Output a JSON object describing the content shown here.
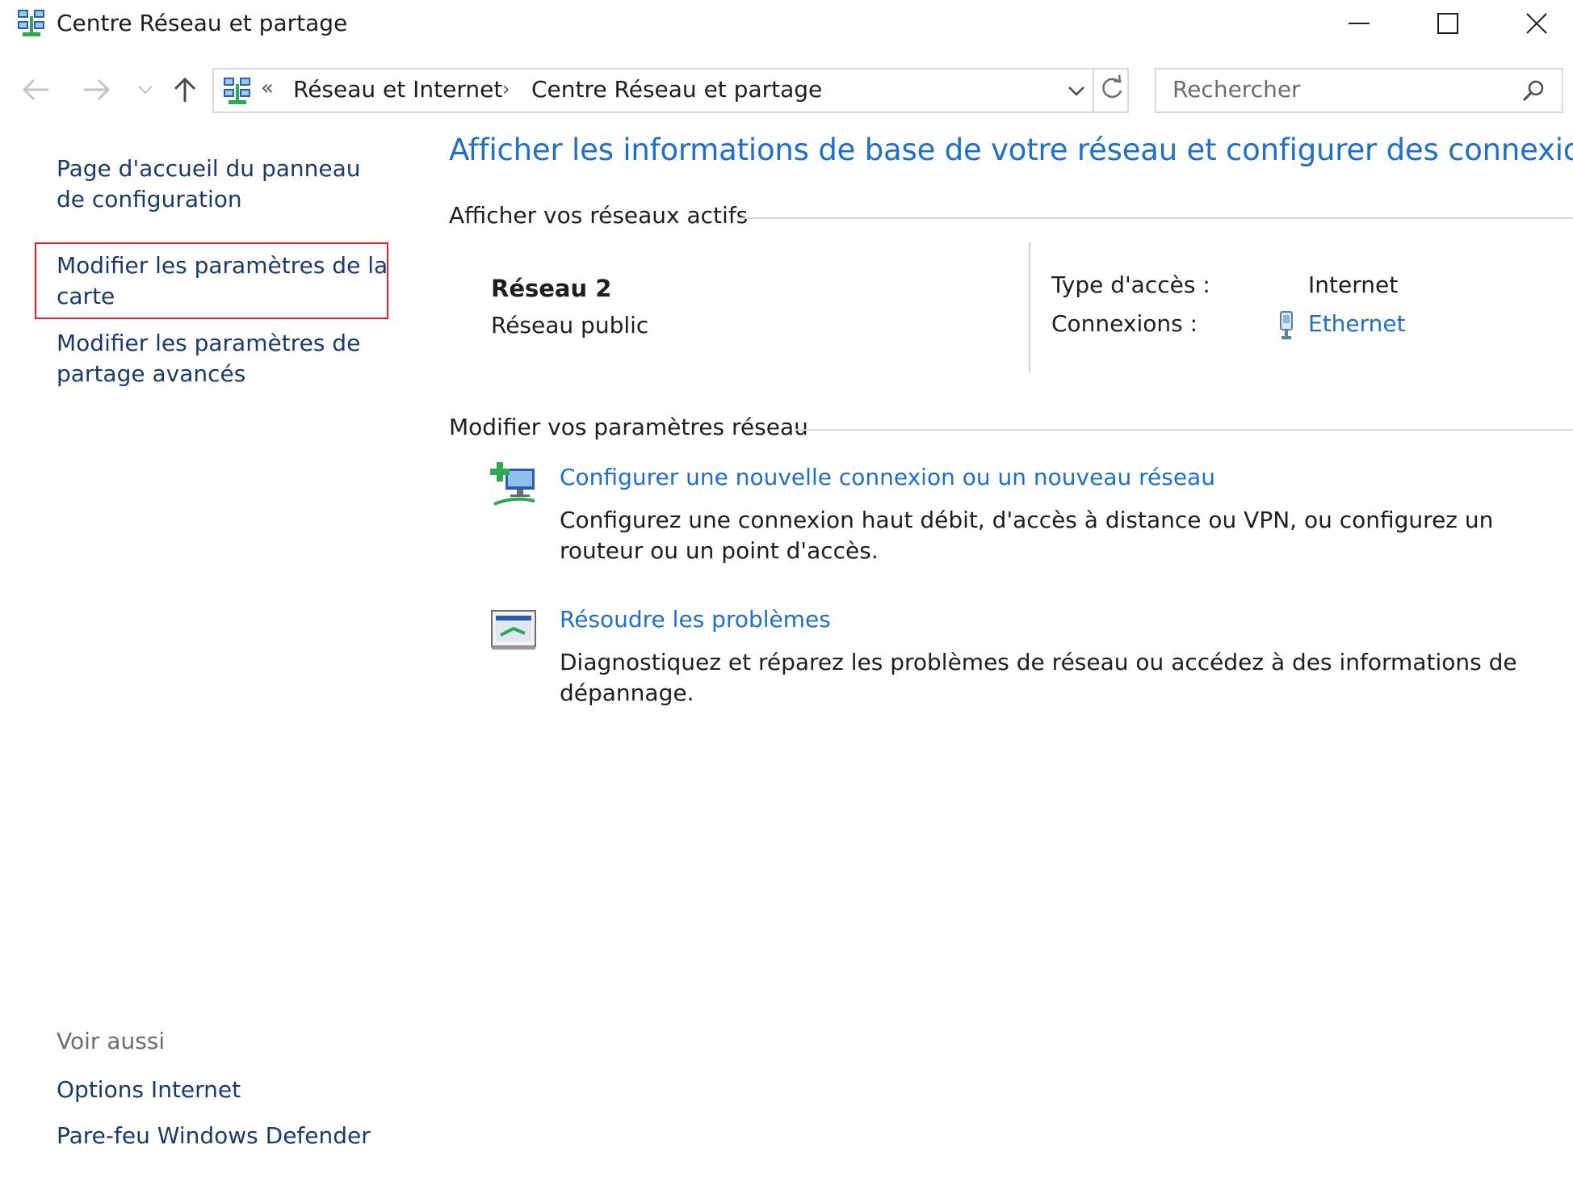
{
  "window": {
    "title": "Centre Réseau et partage"
  },
  "navigation": {
    "breadcrumb_prefix": "«",
    "breadcrumbs": [
      "Réseau et Internet",
      "Centre Réseau et partage"
    ],
    "breadcrumb_separator": "›",
    "search_placeholder": "Rechercher"
  },
  "sidebar": {
    "links": [
      "Page d'accueil du panneau de configuration",
      "Modifier les paramètres de la carte",
      "Modifier les paramètres de partage avancés"
    ],
    "highlighted_link_color": "#e8202a",
    "see_also_heading": "Voir aussi",
    "see_also_links": [
      "Options Internet",
      "Pare-feu Windows Defender"
    ]
  },
  "main": {
    "title": "Afficher les informations de base de votre réseau et configurer des connexions",
    "active_networks_heading": "Afficher vos réseaux actifs",
    "network": {
      "name": "Réseau 2",
      "category": "Réseau public",
      "access_type_label": "Type d'accès :",
      "access_type_value": "Internet",
      "connections_label": "Connexions :",
      "connections_value": "Ethernet"
    },
    "modify_heading": "Modifier vos paramètres réseau",
    "tasks": [
      {
        "icon": "new-connection-icon",
        "link": "Configurer une nouvelle connexion ou un nouveau réseau",
        "description": "Configurez une connexion haut débit, d'accès à distance ou VPN, ou configurez un routeur ou un point d'accès."
      },
      {
        "icon": "troubleshoot-icon",
        "link": "Résoudre les problèmes",
        "description": "Diagnostiquez et réparez les problèmes de réseau ou accédez à des informations de dépannage."
      }
    ]
  },
  "colors": {
    "link_blue": "#1e6fc7",
    "nav_link": "#1a3a6b",
    "muted_text": "#6d6d6d"
  }
}
